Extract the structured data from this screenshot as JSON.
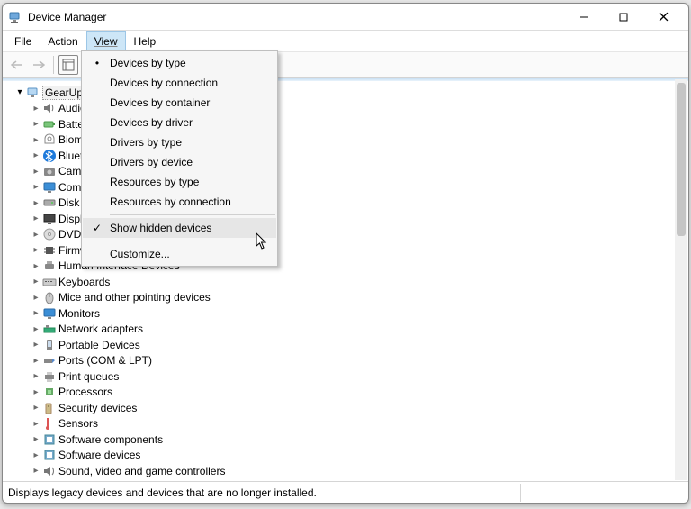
{
  "title": "Device Manager",
  "menubar": {
    "file": "File",
    "action": "Action",
    "view": "View",
    "help": "Help"
  },
  "view_menu": {
    "devices_by_type": "Devices by type",
    "devices_by_connection": "Devices by connection",
    "devices_by_container": "Devices by container",
    "devices_by_driver": "Devices by driver",
    "drivers_by_type": "Drivers by type",
    "drivers_by_device": "Drivers by device",
    "resources_by_type": "Resources by type",
    "resources_by_connection": "Resources by connection",
    "show_hidden": "Show hidden devices",
    "customize": "Customize..."
  },
  "tree": {
    "root": "GearUp",
    "items": [
      "Audio",
      "Batteries",
      "Biometric",
      "Bluetooth",
      "Cameras",
      "Computer",
      "Disk drives",
      "Display adapters",
      "DVD/CD-ROM",
      "Firmware",
      "Human Interface Devices",
      "Keyboards",
      "Mice and other pointing devices",
      "Monitors",
      "Network adapters",
      "Portable Devices",
      "Ports (COM & LPT)",
      "Print queues",
      "Processors",
      "Security devices",
      "Sensors",
      "Software components",
      "Software devices",
      "Sound, video and game controllers"
    ]
  },
  "status": "Displays legacy devices and devices that are no longer installed."
}
